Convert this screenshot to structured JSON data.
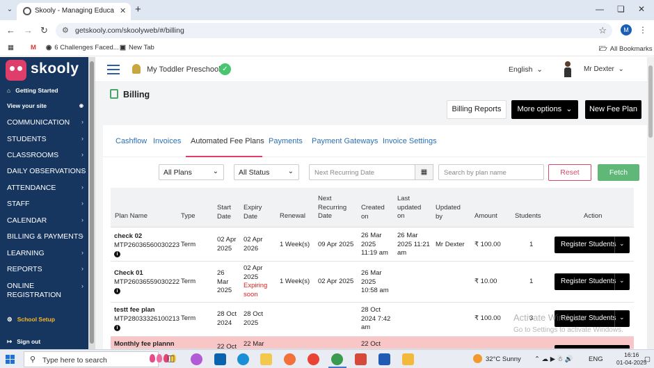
{
  "browser": {
    "tab_title": "Skooly - Managing Educational",
    "url": "getskooly.com/skoolyweb/#/billing",
    "profile_initial": "M",
    "bookmarks": [
      "6 Challenges Faced...",
      "New Tab"
    ],
    "all_bookmarks": "All Bookmarks"
  },
  "sidebar": {
    "brand": "skooly",
    "getting_started": "Getting Started",
    "view_site": "View your site",
    "items": [
      "COMMUNICATION",
      "STUDENTS",
      "CLASSROOMS",
      "DAILY OBSERVATIONS",
      "ATTENDANCE",
      "STAFF",
      "CALENDAR",
      "BILLING & PAYMENTS",
      "LEARNING",
      "REPORTS"
    ],
    "online_registration_1": "ONLINE",
    "online_registration_2": "REGISTRATION",
    "school_setup": "School Setup",
    "sign_out": "Sign out"
  },
  "header": {
    "school": "My Toddler Preschool",
    "language": "English",
    "user": "Mr Dexter"
  },
  "page": {
    "title": "Billing",
    "billing_reports": "Billing Reports",
    "more_options": "More options",
    "new_fee_plan": "New Fee Plan"
  },
  "tabs": [
    "Cashflow",
    "Invoices",
    "Automated Fee Plans",
    "Payments",
    "Payment Gateways",
    "Invoice Settings"
  ],
  "active_tab": "Automated Fee Plans",
  "filters": {
    "plans": "All Plans",
    "status": "All Status",
    "next_recurring_placeholder": "Next Recurring Date",
    "search_placeholder": "Search by plan name",
    "reset": "Reset",
    "fetch": "Fetch"
  },
  "table": {
    "headers": {
      "plan_name": "Plan Name",
      "type": "Type",
      "start_1": "Start",
      "start_2": "Date",
      "expiry_1": "Expiry",
      "expiry_2": "Date",
      "renewal": "Renewal",
      "next_1": "Next",
      "next_2": "Recurring",
      "next_3": "Date",
      "created_1": "Created",
      "created_2": "on",
      "updated_1": "Last",
      "updated_2": "updated",
      "updated_3": "on",
      "by_1": "Updated",
      "by_2": "by",
      "amount": "Amount",
      "students": "Students",
      "action": "Action"
    },
    "rows": [
      {
        "name": "check 02",
        "code": "MTP26036560030223",
        "type": "Term",
        "start_1": "02 Apr",
        "start_2": "2025",
        "start_3": "",
        "expiry_1": "02 Apr",
        "expiry_2": "2026",
        "expiry_3": "",
        "expiry_4": "",
        "renewal": "1 Week(s)",
        "next": "09 Apr 2025",
        "created_1": "26 Mar",
        "created_2": "2025",
        "created_3": "11:19 am",
        "updated_1": "26 Mar",
        "updated_2": "2025 11:21",
        "updated_3": "am",
        "by": "Mr Dexter",
        "amount": "₹ 100.00",
        "students": "1",
        "action": "Register Students"
      },
      {
        "name": "Check 01",
        "code": "MTP26036559030222",
        "type": "Term",
        "start_1": "26",
        "start_2": "Mar",
        "start_3": "2025",
        "expiry_1": "02 Apr",
        "expiry_2": "2025",
        "expiry_3": "Expiring",
        "expiry_4": "soon",
        "renewal": "1 Week(s)",
        "next": "02 Apr 2025",
        "created_1": "26 Mar",
        "created_2": "2025",
        "created_3": "10:58 am",
        "updated_1": "",
        "updated_2": "",
        "updated_3": "",
        "by": "",
        "amount": "₹ 10.00",
        "students": "1",
        "action": "Register Students"
      },
      {
        "name": "testt fee plan",
        "code": "MTP28033326100213",
        "type": "Term",
        "start_1": "28 Oct",
        "start_2": "2024",
        "start_3": "",
        "expiry_1": "28 Oct",
        "expiry_2": "2025",
        "expiry_3": "",
        "expiry_4": "",
        "renewal": "",
        "next": "",
        "created_1": "28 Oct",
        "created_2": "2024 7:42",
        "created_3": "am",
        "updated_1": "",
        "updated_2": "",
        "updated_3": "",
        "by": "",
        "amount": "₹ 100.00",
        "students": "3",
        "action": "Register Students"
      },
      {
        "name": "Monthly fee plannn",
        "code": "",
        "type": "",
        "start_1": "22 Oct",
        "start_2": "",
        "start_3": "",
        "expiry_1": "22 Mar",
        "expiry_2": "",
        "expiry_3": "",
        "expiry_4": "",
        "renewal": "",
        "next": "",
        "created_1": "22 Oct",
        "created_2": "",
        "created_3": "",
        "updated_1": "",
        "updated_2": "",
        "updated_3": "",
        "by": "",
        "amount": "",
        "students": "",
        "action": ""
      }
    ]
  },
  "watermark": {
    "line1": "Activate Windows",
    "line2": "Go to Settings to activate Windows."
  },
  "taskbar": {
    "search_placeholder": "Type here to search",
    "weather": "32°C  Sunny",
    "lang": "ENG",
    "time": "16:16",
    "date": "01-04-2025"
  }
}
